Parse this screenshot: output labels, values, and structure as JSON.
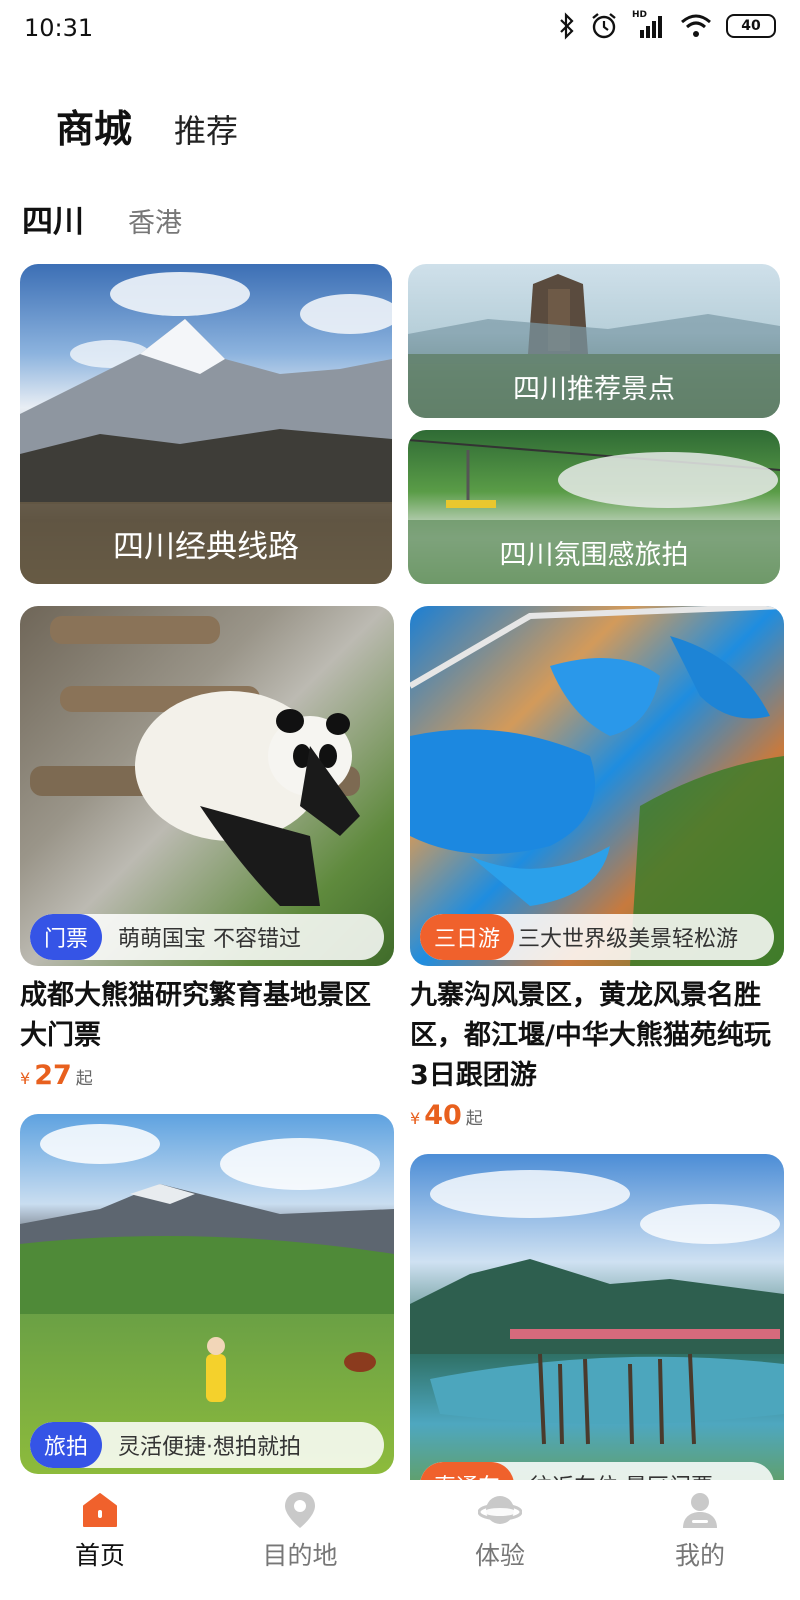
{
  "status": {
    "time": "10:31",
    "battery": "40",
    "network": "HD"
  },
  "header": {
    "tabs": [
      "商城",
      "推荐"
    ]
  },
  "regions": [
    "四川",
    "香港"
  ],
  "banners": [
    {
      "label": "四川经典线路"
    },
    {
      "label": "四川推荐景点"
    },
    {
      "label": "四川氛围感旅拍"
    }
  ],
  "products": [
    {
      "tag": "门票",
      "tag_color": "#3554e6",
      "subtitle": "萌萌国宝  不容错过",
      "title": "成都大熊猫研究繁育基地景区大门票",
      "currency": "¥",
      "price": "27",
      "price_suffix": "起"
    },
    {
      "tag": "三日游",
      "tag_color": "#f0612c",
      "subtitle": "三大世界级美景轻松游",
      "title": "九寨沟风景区，黄龙风景名胜区，都江堰/中华大熊猫苑纯玩3日跟团游",
      "currency": "¥",
      "price": "40",
      "price_suffix": "起"
    },
    {
      "tag": "旅拍",
      "tag_color": "#3554e6",
      "subtitle": "灵活便捷·想拍就拍"
    },
    {
      "tag": "直通车",
      "tag_color": "#f0612c",
      "subtitle": "往返车位·景区门票"
    }
  ],
  "bottom_nav": [
    {
      "label": "首页",
      "icon": "home-icon",
      "active": true
    },
    {
      "label": "目的地",
      "icon": "location-pin-icon",
      "active": false
    },
    {
      "label": "体验",
      "icon": "planet-icon",
      "active": false
    },
    {
      "label": "我的",
      "icon": "user-icon",
      "active": false
    }
  ],
  "colors": {
    "accent": "#f0612c",
    "blue_tag": "#3554e6",
    "price": "#e8601e"
  }
}
